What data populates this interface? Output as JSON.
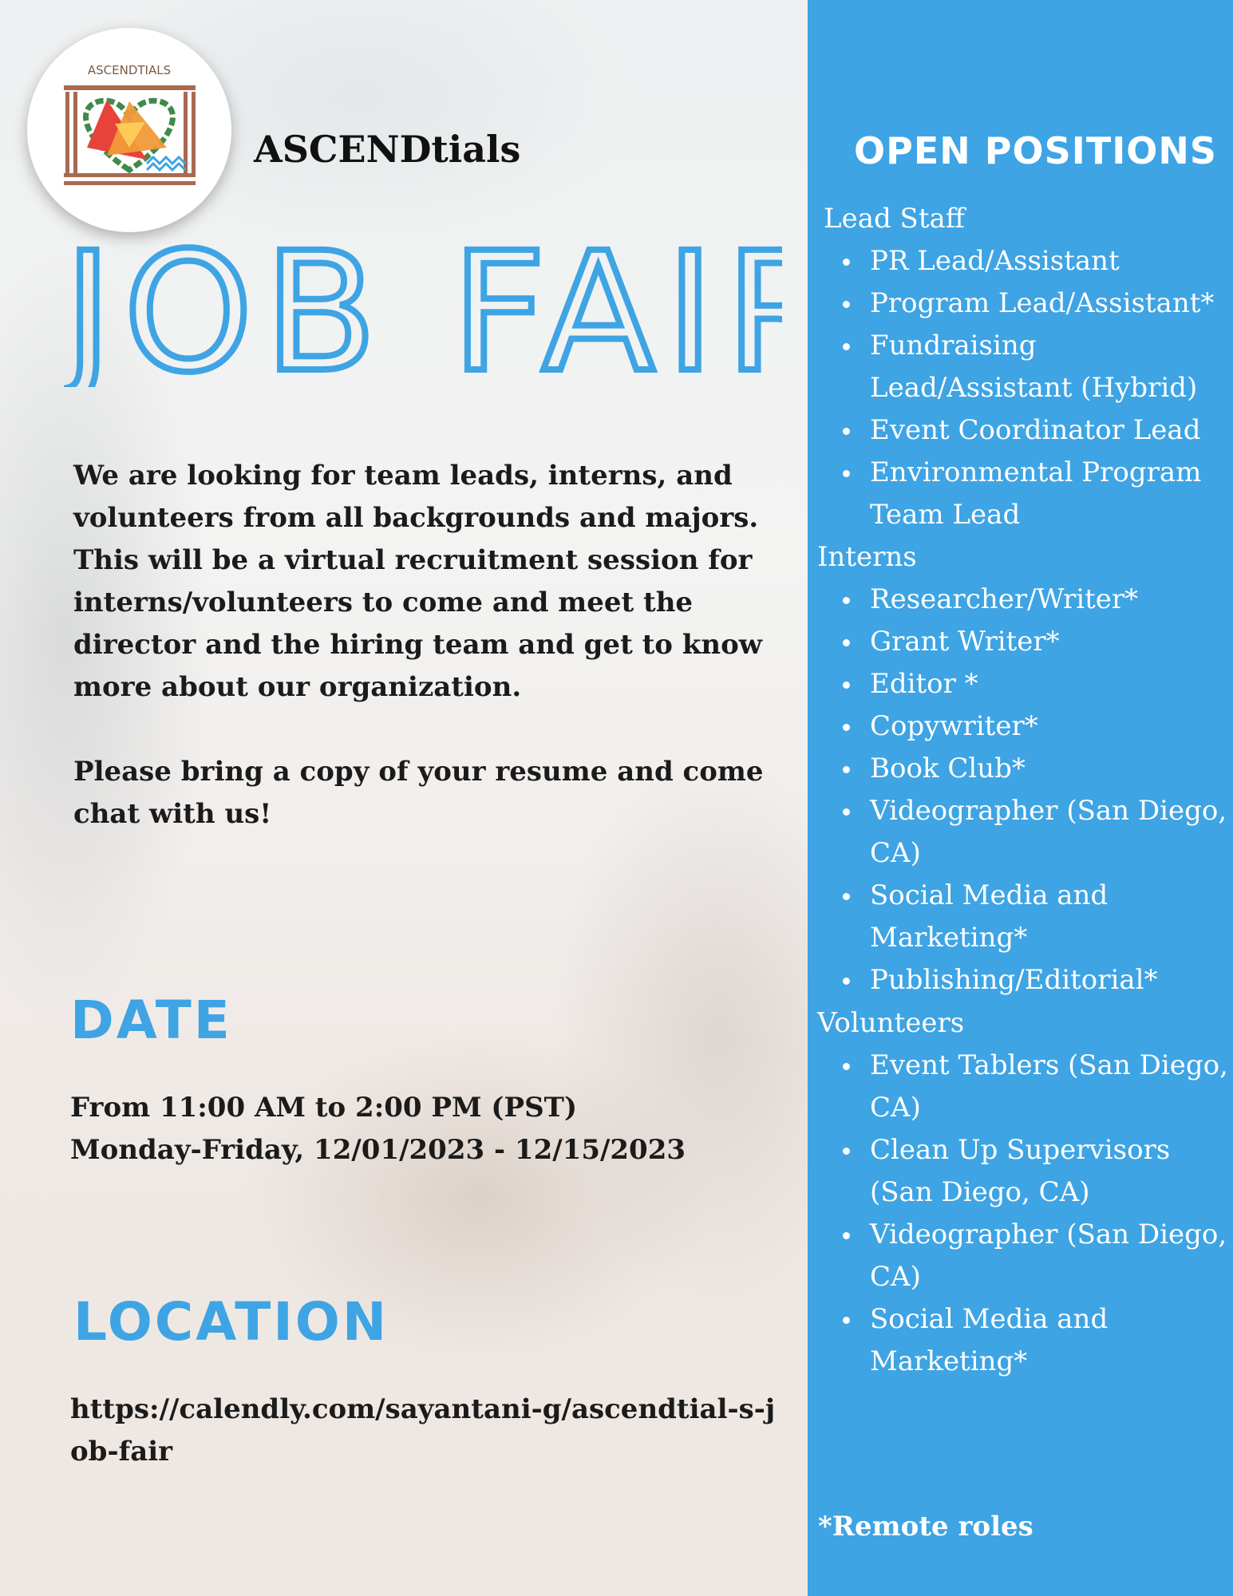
{
  "logo": {
    "text": "ASCENDTIALS"
  },
  "brand_name": "ASCENDtials",
  "title": "JOB FAIR",
  "intro": {
    "paragraph1": "We are looking for team leads, interns, and volunteers from all backgrounds and majors. This will be a virtual recruitment session for interns/volunteers to come and meet the director and the hiring team and get to know more about our organization.",
    "paragraph2": "Please bring a copy of your resume and come chat with us!"
  },
  "date": {
    "heading": "DATE",
    "time": "From 11:00 AM to 2:00 PM (PST)",
    "days": "Monday-Friday, 12/01/2023 - 12/15/2023"
  },
  "location": {
    "heading": "LOCATION",
    "link": "https://calendly.com/sayantani-g/ascendtial-s-job-fair"
  },
  "positions": {
    "title": "OPEN POSITIONS",
    "lead_staff": {
      "label": "Lead Staff",
      "items": [
        "PR Lead/Assistant",
        "Program Lead/Assistant*",
        "Fundraising Lead/Assistant (Hybrid)",
        "Event Coordinator Lead",
        "Environmental Program Team Lead"
      ]
    },
    "interns": {
      "label": "Interns",
      "items": [
        "Researcher/Writer*",
        "Grant Writer*",
        "Editor *",
        "Copywriter*",
        "Book Club*",
        "Videographer (San Diego, CA)",
        "Social Media and Marketing*",
        "Publishing/Editorial*"
      ]
    },
    "volunteers": {
      "label": "Volunteers",
      "items": [
        "Event Tablers (San Diego, CA)",
        "Clean Up Supervisors (San Diego, CA)",
        " Videographer (San Diego, CA)",
        "Social Media and Marketing*"
      ]
    },
    "note": "*Remote roles"
  },
  "colors": {
    "accent": "#3ea4e4",
    "text": "#1b1b1b"
  }
}
